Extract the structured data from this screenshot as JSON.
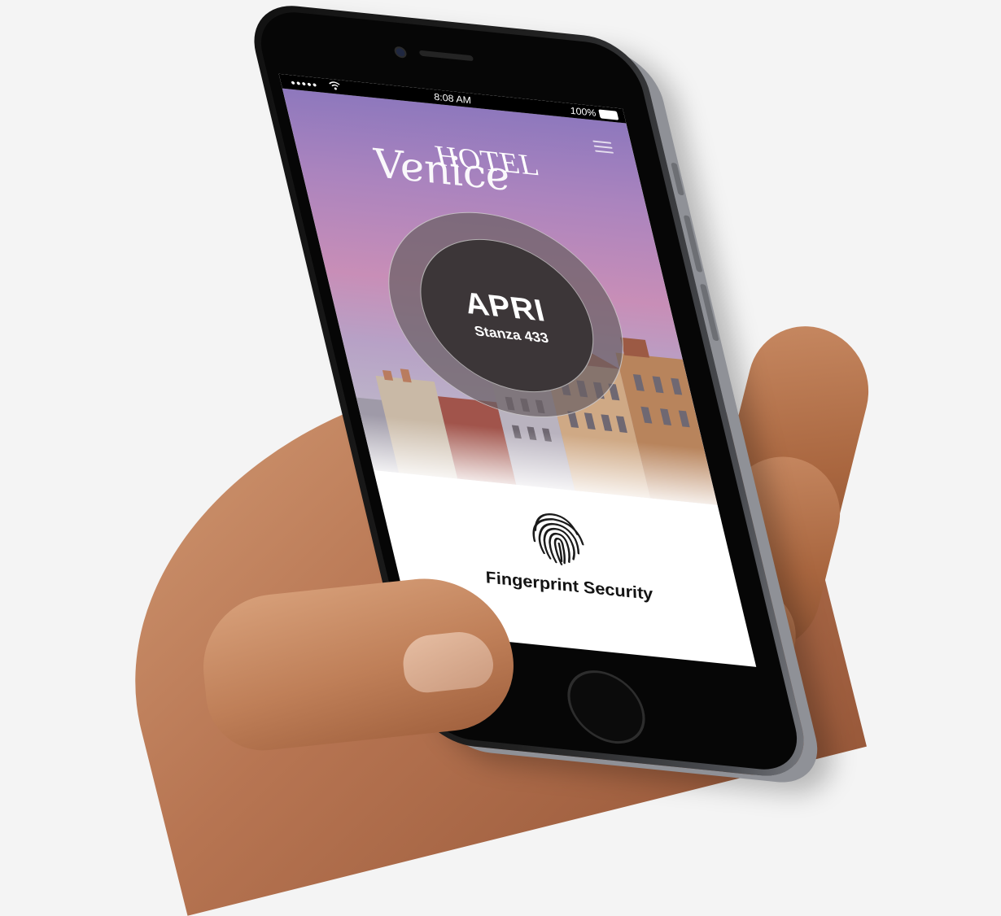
{
  "status_bar": {
    "signal": "●●●●●",
    "time": "8:08 AM",
    "battery": "100%"
  },
  "app": {
    "logo_hotel": "HOTEL",
    "logo_venice": "Venice",
    "unlock_label": "APRI",
    "room_label": "Stanza 433",
    "fingerprint_label": "Fingerprint Security"
  },
  "icons": {
    "menu": "menu-icon",
    "wifi": "wifi-icon",
    "battery": "battery-icon",
    "fingerprint": "fingerprint-icon"
  },
  "colors": {
    "background": "#f4f4f4",
    "phone_body": "#1c1c1c",
    "sky_top": "#8e78bd",
    "sky_mid": "#c88eb7",
    "button_ring": "#695f64",
    "button_core": "#3c3638"
  }
}
